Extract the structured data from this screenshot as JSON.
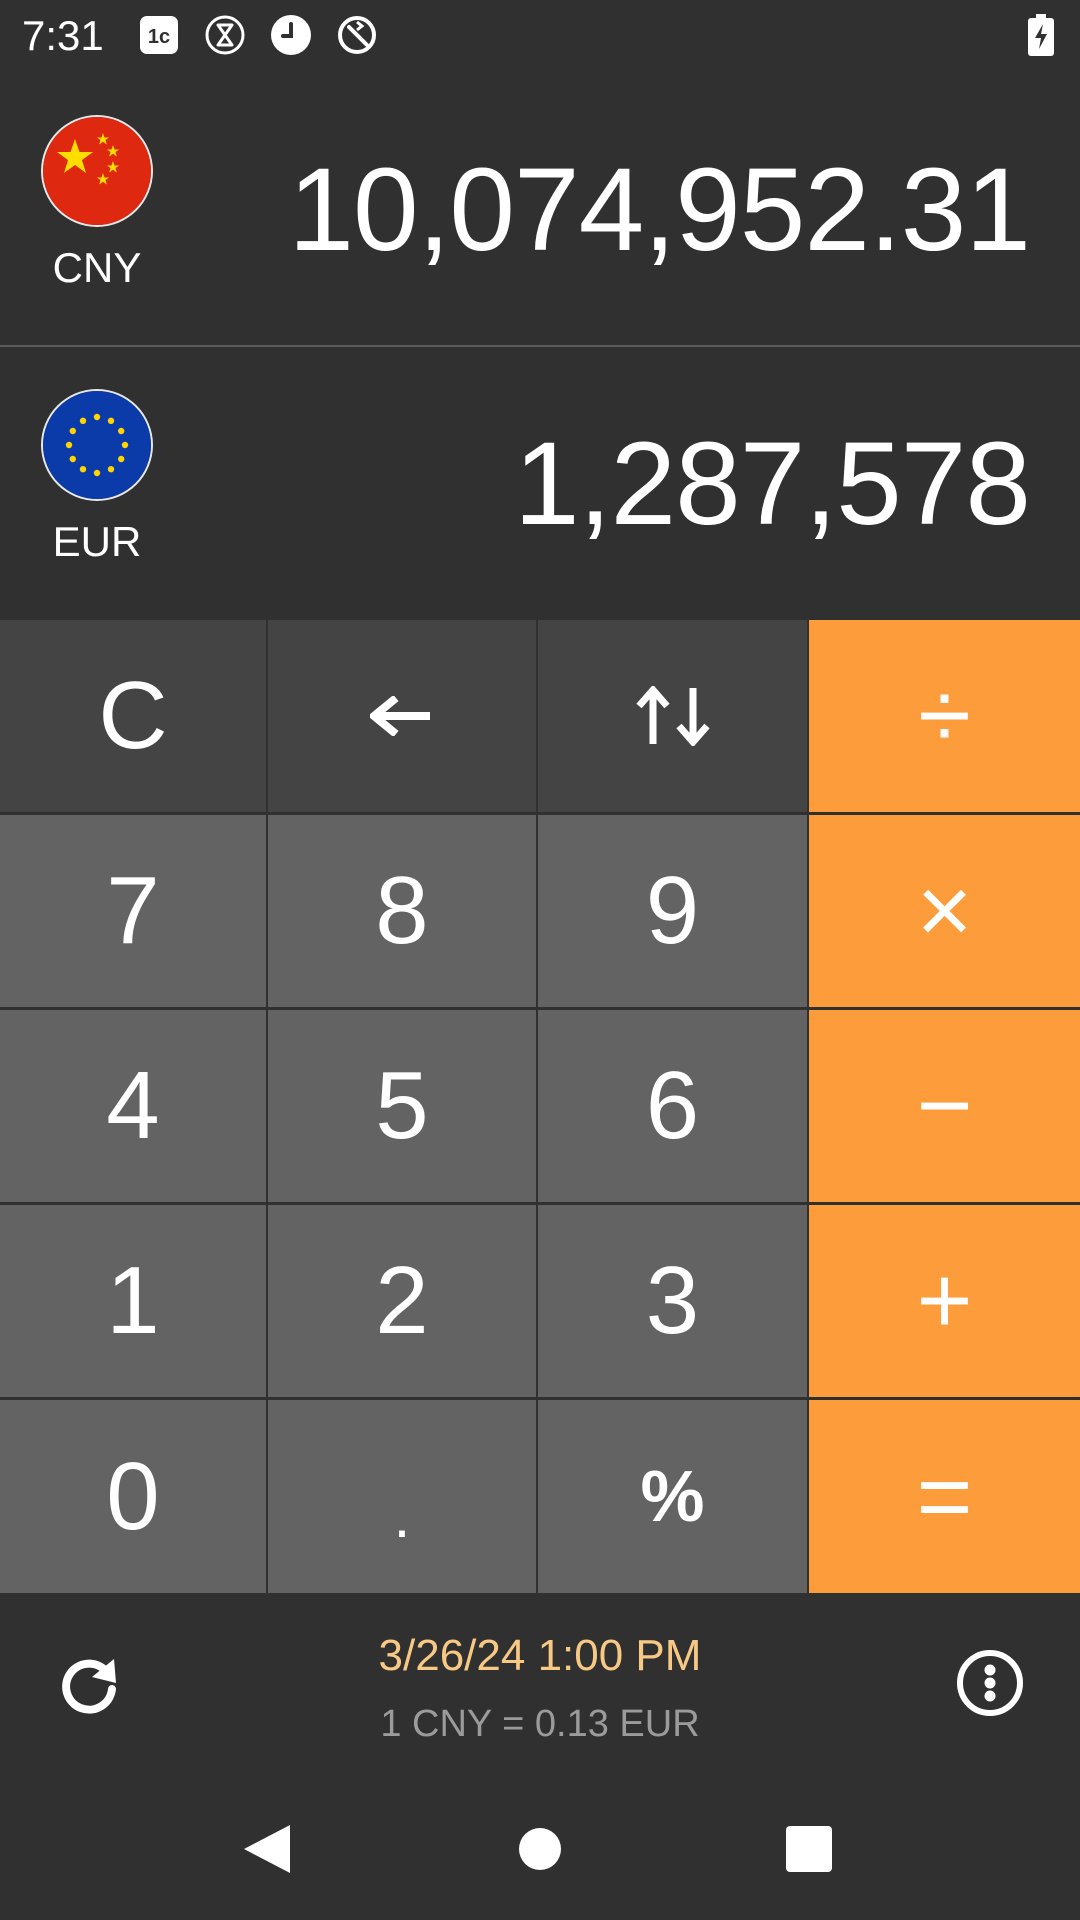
{
  "status": {
    "time": "7:31",
    "icons": [
      "sim-icon",
      "hourglass-icon",
      "clock-icon",
      "no-sync-icon",
      "battery-charging-icon"
    ]
  },
  "from_currency": {
    "code": "CNY",
    "amount": "10,074,952.31",
    "flag": "china-flag-icon"
  },
  "to_currency": {
    "code": "EUR",
    "amount": "1,287,578",
    "flag": "eu-flag-icon"
  },
  "keypad": {
    "clear": "C",
    "backspace": "←",
    "swap": "↑↓",
    "divide": "÷",
    "multiply": "×",
    "minus": "−",
    "plus": "+",
    "equals": "=",
    "seven": "7",
    "eight": "8",
    "nine": "9",
    "four": "4",
    "five": "5",
    "six": "6",
    "one": "1",
    "two": "2",
    "three": "3",
    "zero": "0",
    "decimal": ".",
    "percent": "%"
  },
  "info": {
    "updated": "3/26/24 1:00 PM",
    "rate": "1 CNY = 0.13 EUR"
  },
  "colors": {
    "background": "#303030",
    "operator": "#fd9c3b",
    "digit_key": "#636363",
    "function_key": "#444444",
    "date_text": "#f8c985",
    "rate_text": "#9b9b9b"
  }
}
